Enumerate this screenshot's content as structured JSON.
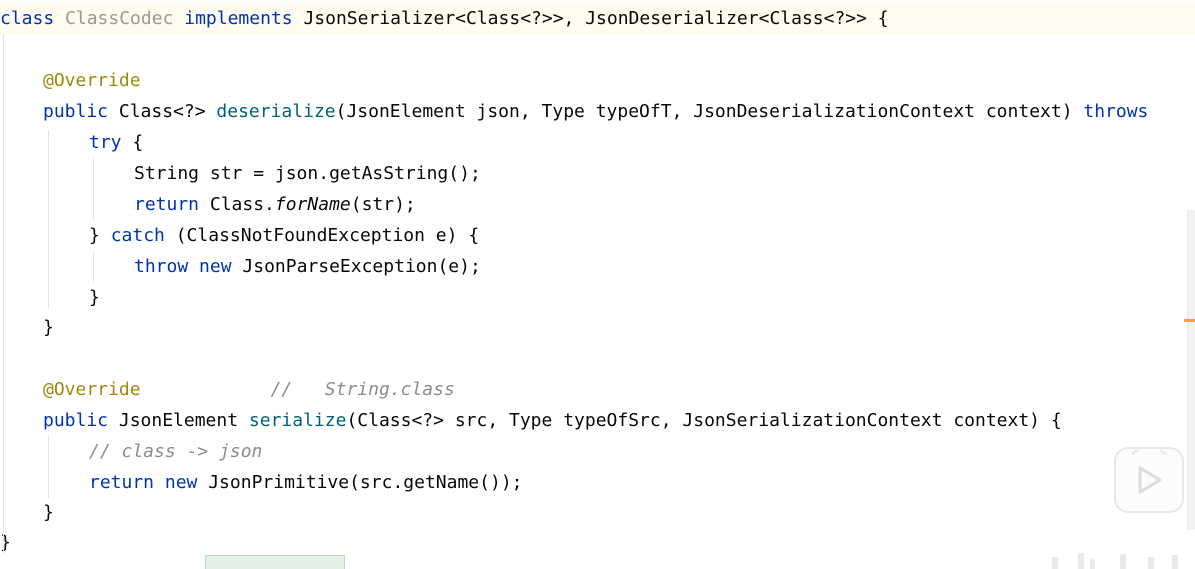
{
  "code": {
    "lines": [
      {
        "tokens": [
          {
            "t": "class ",
            "c": "kw"
          },
          {
            "t": "ClassCodec",
            "c": "cls-dim"
          },
          {
            "t": " implements ",
            "c": "kw"
          },
          {
            "t": "JsonSerializer<Class<?>>, JsonDeserializer<Class<?>> {",
            "c": ""
          }
        ]
      },
      {
        "tokens": []
      },
      {
        "tokens": [
          {
            "t": "@Override",
            "c": "anno"
          }
        ]
      },
      {
        "tokens": [
          {
            "t": "public ",
            "c": "kw"
          },
          {
            "t": "Class<?> ",
            "c": ""
          },
          {
            "t": "deserialize",
            "c": "fn"
          },
          {
            "t": "(JsonElement json, Type typeOfT, JsonDeserializationContext context) ",
            "c": ""
          },
          {
            "t": "throws",
            "c": "kw"
          }
        ]
      },
      {
        "tokens": [
          {
            "t": "try ",
            "c": "kw"
          },
          {
            "t": "{",
            "c": ""
          }
        ]
      },
      {
        "tokens": [
          {
            "t": "String str = json.getAsString();",
            "c": ""
          }
        ]
      },
      {
        "tokens": [
          {
            "t": "return ",
            "c": "kw"
          },
          {
            "t": "Class.",
            "c": ""
          },
          {
            "t": "forName",
            "c": "ital"
          },
          {
            "t": "(str);",
            "c": ""
          }
        ]
      },
      {
        "tokens": [
          {
            "t": "} ",
            "c": ""
          },
          {
            "t": "catch ",
            "c": "kw"
          },
          {
            "t": "(ClassNotFoundException e) {",
            "c": ""
          }
        ]
      },
      {
        "tokens": [
          {
            "t": "throw ",
            "c": "kw"
          },
          {
            "t": "new ",
            "c": "kw"
          },
          {
            "t": "JsonParseException(e);",
            "c": ""
          }
        ]
      },
      {
        "tokens": [
          {
            "t": "}",
            "c": ""
          }
        ]
      },
      {
        "tokens": [
          {
            "t": "}",
            "c": ""
          }
        ]
      },
      {
        "tokens": []
      },
      {
        "tokens": [
          {
            "t": "@Override",
            "c": "anno"
          },
          {
            "t": "            //   String.class",
            "c": "cmt"
          }
        ]
      },
      {
        "tokens": [
          {
            "t": "public ",
            "c": "kw"
          },
          {
            "t": "JsonElement ",
            "c": ""
          },
          {
            "t": "serialize",
            "c": "fn"
          },
          {
            "t": "(Class<?> src, Type typeOfSrc, JsonSerializationContext context) {",
            "c": ""
          }
        ]
      },
      {
        "tokens": [
          {
            "t": "// class -> json",
            "c": "cmt"
          }
        ]
      },
      {
        "tokens": [
          {
            "t": "return ",
            "c": "kw"
          },
          {
            "t": "new ",
            "c": "kw"
          },
          {
            "t": "JsonPrimitive(src.getName());",
            "c": ""
          }
        ]
      },
      {
        "tokens": [
          {
            "t": "}",
            "c": ""
          }
        ]
      },
      {
        "tokens": [
          {
            "t": "}",
            "c": ""
          }
        ]
      }
    ]
  },
  "overlay": {
    "play_button_icon": "play-icon"
  }
}
